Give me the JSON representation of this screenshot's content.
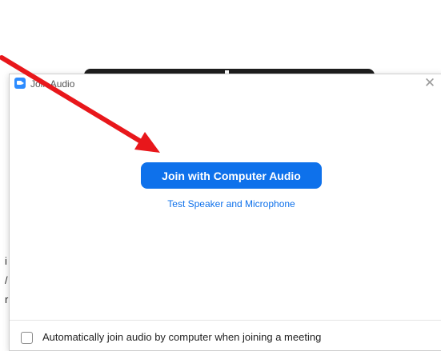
{
  "dialog": {
    "title": "Join Audio",
    "close_icon": "close-icon",
    "app_icon": "zoom-camera-icon"
  },
  "main": {
    "join_button_label": "Join with Computer Audio",
    "test_link_label": "Test Speaker and Microphone"
  },
  "footer": {
    "auto_join_label": "Automatically join audio by computer when joining a meeting",
    "auto_join_checked": false
  },
  "colors": {
    "accent": "#0e71eb",
    "annotation": "#e8171b"
  }
}
